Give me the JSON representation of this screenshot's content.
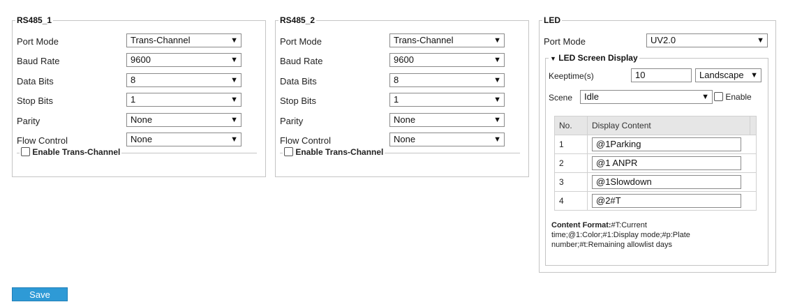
{
  "rs485_1": {
    "title": "RS485_1",
    "port_mode_label": "Port Mode",
    "port_mode_value": "Trans-Channel",
    "baud_rate_label": "Baud Rate",
    "baud_rate_value": "9600",
    "data_bits_label": "Data Bits",
    "data_bits_value": "8",
    "stop_bits_label": "Stop Bits",
    "stop_bits_value": "1",
    "parity_label": "Parity",
    "parity_value": "None",
    "flow_control_label": "Flow Control",
    "flow_control_value": "None",
    "trans_channel_label": "Enable Trans-Channel"
  },
  "rs485_2": {
    "title": "RS485_2",
    "port_mode_label": "Port Mode",
    "port_mode_value": "Trans-Channel",
    "baud_rate_label": "Baud Rate",
    "baud_rate_value": "9600",
    "data_bits_label": "Data Bits",
    "data_bits_value": "8",
    "stop_bits_label": "Stop Bits",
    "stop_bits_value": "1",
    "parity_label": "Parity",
    "parity_value": "None",
    "flow_control_label": "Flow Control",
    "flow_control_value": "None",
    "trans_channel_label": "Enable Trans-Channel"
  },
  "led": {
    "title": "LED",
    "port_mode_label": "Port Mode",
    "port_mode_value": "UV2.0",
    "screen_display_label": "LED Screen Display",
    "keeptime_label": "Keeptime(s)",
    "keeptime_value": "10",
    "orientation_value": "Landscape",
    "scene_label": "Scene",
    "scene_value": "Idle",
    "enable_label": "Enable",
    "table_headers": [
      "No.",
      "Display Content"
    ],
    "rows": [
      {
        "no": "1",
        "content": "@1Parking"
      },
      {
        "no": "2",
        "content": "@1 ANPR"
      },
      {
        "no": "3",
        "content": "@1Slowdown"
      },
      {
        "no": "4",
        "content": "@2#T"
      }
    ],
    "format_label": "Content Format:",
    "format_text_1": "#T:Current",
    "format_text_2": "time;@1:Color;#1:Display mode;#p:Plate",
    "format_text_3": "number;#t:Remaining allowlist days"
  },
  "save_label": "Save",
  "icons": {
    "dropdown": "chevron-down-icon",
    "collapse": "triangle-down-icon",
    "checkbox": "checkbox-icon"
  },
  "colors": {
    "accent": "#2e9ad6",
    "border": "#c4c4c4",
    "table_header": "#e6e6e6"
  }
}
